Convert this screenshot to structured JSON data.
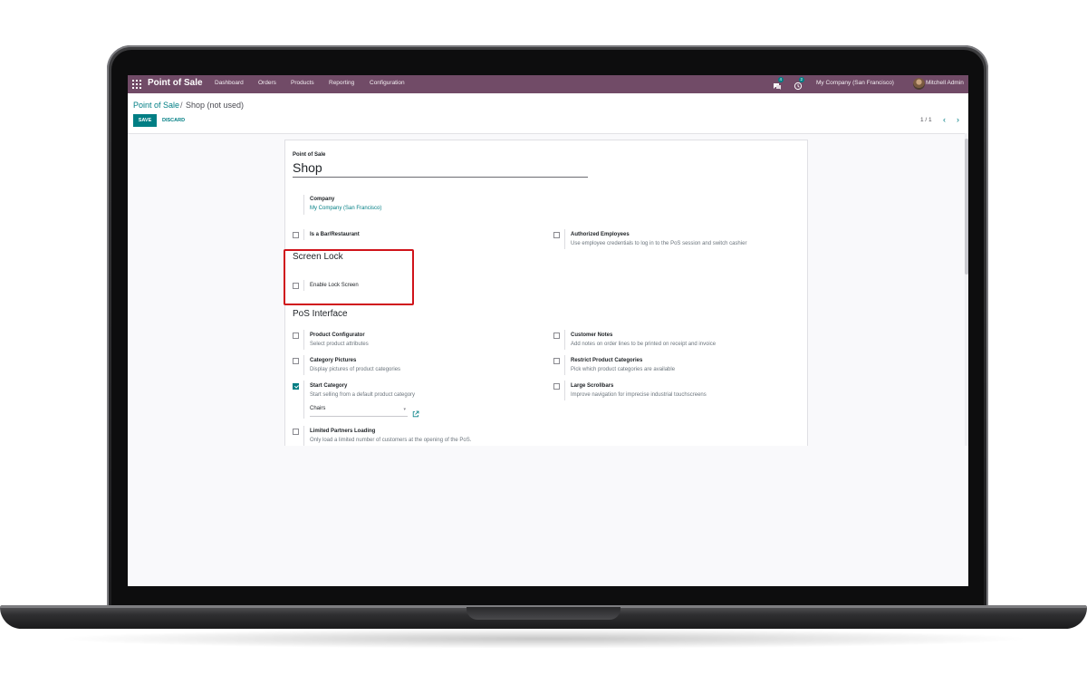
{
  "navbar": {
    "app_title": "Point of Sale",
    "menu": [
      "Dashboard",
      "Orders",
      "Products",
      "Reporting",
      "Configuration"
    ],
    "messages_count": "4",
    "activities_count": "2",
    "company": "My Company (San Francisco)",
    "user": "Mitchell Admin"
  },
  "breadcrumb": {
    "root": "Point of Sale",
    "separator": "/",
    "current": "Shop (not used)"
  },
  "toolbar": {
    "save_label": "SAVE",
    "discard_label": "DISCARD"
  },
  "pager": {
    "value": "1 / 1"
  },
  "form": {
    "name_label": "Point of Sale",
    "name_value": "Shop",
    "company_label": "Company",
    "company_value": "My Company (San Francisco)",
    "bar_restaurant": {
      "title": "Is a Bar/Restaurant",
      "checked": false
    },
    "authorized_employees": {
      "title": "Authorized Employees",
      "desc": "Use employee credentials to log in to the PoS session and switch cashier",
      "checked": false
    },
    "screen_lock_section": "Screen Lock",
    "enable_lock_screen": {
      "title": "Enable Lock Screen",
      "checked": false
    },
    "pos_interface_section": "PoS Interface",
    "product_configurator": {
      "title": "Product Configurator",
      "desc": "Select product attributes",
      "checked": false
    },
    "customer_notes": {
      "title": "Customer Notes",
      "desc": "Add notes on order lines to be printed on receipt and invoice",
      "checked": false
    },
    "category_pictures": {
      "title": "Category Pictures",
      "desc": "Display pictures of product categories",
      "checked": false
    },
    "restrict_categories": {
      "title": "Restrict Product Categories",
      "desc": "Pick which product categories are available",
      "checked": false
    },
    "start_category": {
      "title": "Start Category",
      "desc": "Start selling from a default product category",
      "checked": true,
      "value": "Chairs"
    },
    "large_scrollbars": {
      "title": "Large Scrollbars",
      "desc": "Improve navigation for imprecise industrial touchscreens",
      "checked": false
    },
    "limited_partners": {
      "title": "Limited Partners Loading",
      "desc": "Only load a limited number of customers at the opening of the PoS.",
      "checked": false
    }
  },
  "colors": {
    "navbar": "#714b67",
    "accent": "#017e84",
    "highlight": "#d0131a"
  }
}
